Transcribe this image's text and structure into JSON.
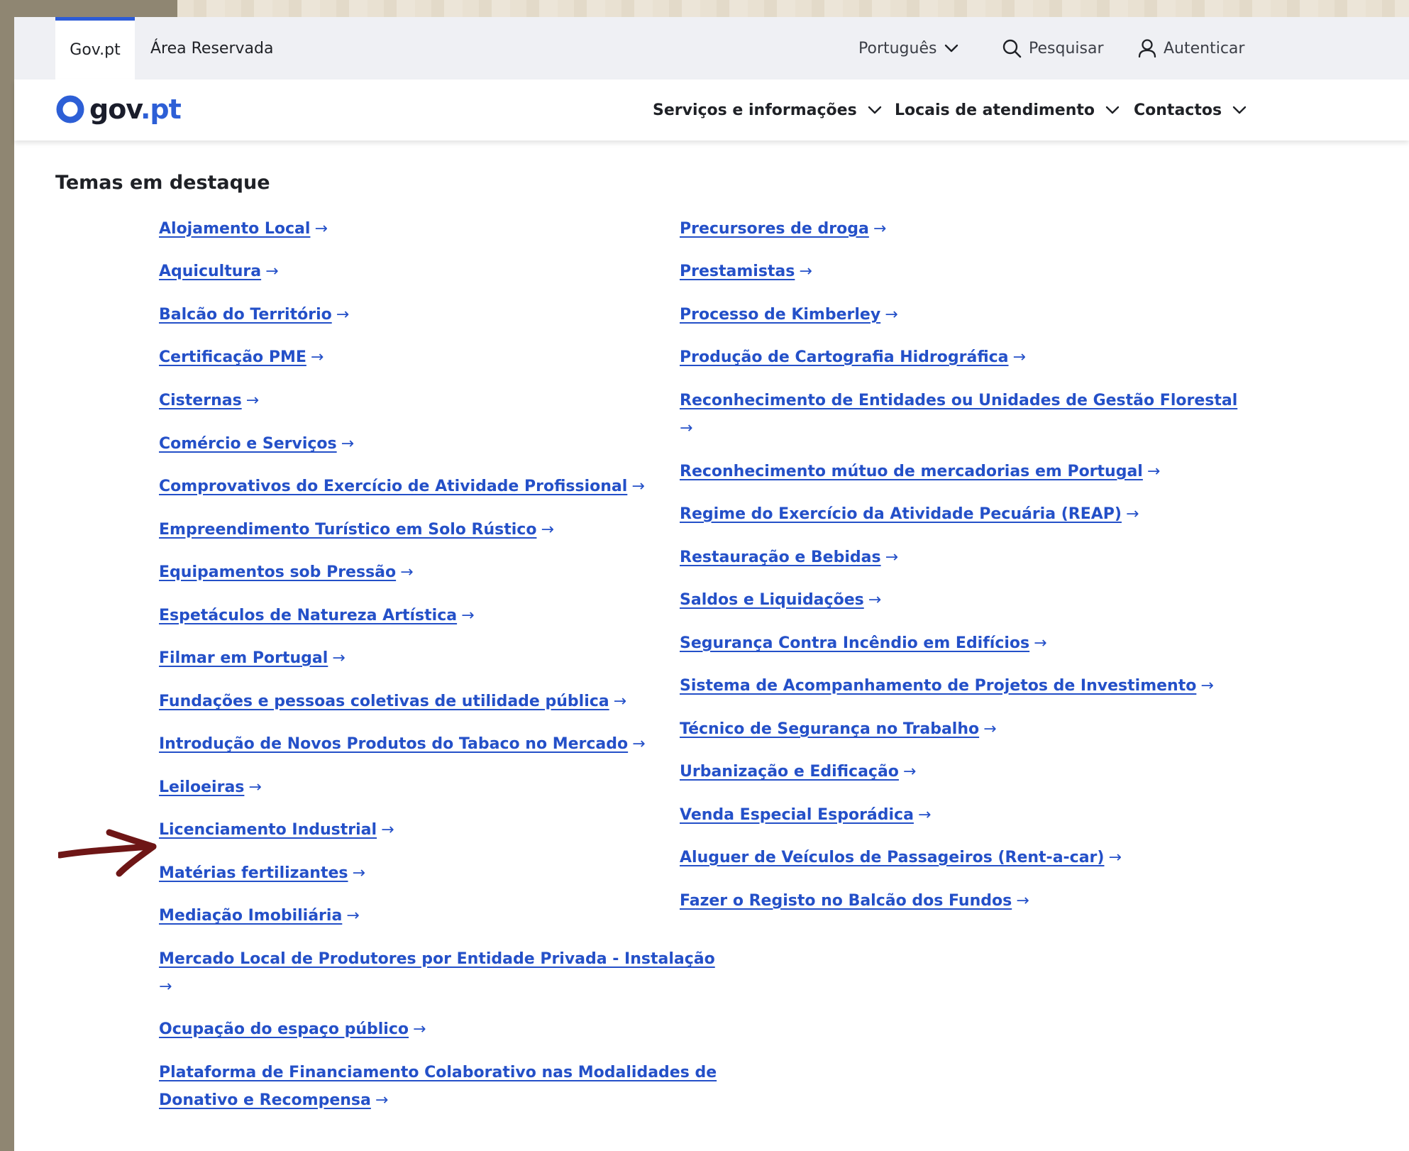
{
  "utility_bar": {
    "tab_govpt": "Gov.pt",
    "tab_reserved": "Área Reservada",
    "language": "Português",
    "search": "Pesquisar",
    "login": "Autenticar"
  },
  "main_nav": {
    "logo_text_a": "gov",
    "logo_text_b": ".pt",
    "items": [
      "Serviços e informações",
      "Locais de atendimento",
      "Contactos"
    ]
  },
  "section": {
    "title": "Temas em destaque"
  },
  "left_links": [
    "Alojamento Local",
    "Aquicultura",
    "Balcão do Território",
    "Certificação PME",
    "Cisternas",
    "Comércio e Serviços",
    "Comprovativos do Exercício de Atividade Profissional",
    "Empreendimento Turístico em Solo Rústico",
    "Equipamentos sob Pressão",
    "Espetáculos de Natureza Artística",
    "Filmar em Portugal",
    "Fundações e pessoas coletivas de utilidade pública",
    "Introdução de Novos Produtos do Tabaco no Mercado",
    "Leiloeiras",
    "Licenciamento Industrial",
    "Matérias fertilizantes",
    "Mediação Imobiliária",
    "Mercado Local de Produtores por Entidade Privada - Instalação",
    "Ocupação do espaço público",
    "Plataforma de Financiamento Colaborativo nas Modalidades de",
    "Donativo e Recompensa"
  ],
  "right_links": [
    "Precursores de droga",
    "Prestamistas",
    "Processo de Kimberley",
    "Produção de Cartografia Hidrográfica",
    "Reconhecimento de Entidades ou Unidades de Gestão Florestal",
    "Reconhecimento mútuo de mercadorias em Portugal",
    "Regime do Exercício da Atividade Pecuária (REAP)",
    "Restauração e Bebidas",
    "Saldos e Liquidações",
    "Segurança Contra Incêndio em Edifícios",
    "Sistema de Acompanhamento de Projetos de Investimento",
    "Técnico de Segurança no Trabalho",
    "Urbanização e Edificação",
    "Venda Especial Esporádica",
    "Aluguer de Veículos de Passageiros (Rent-a-car)",
    "Fazer o Registo no Balcão dos Fundos"
  ],
  "arrow_glyph": "→",
  "colors": {
    "link": "#2450c8",
    "accent": "#2c5bd6",
    "annotation_arrow": "#6e1616"
  }
}
